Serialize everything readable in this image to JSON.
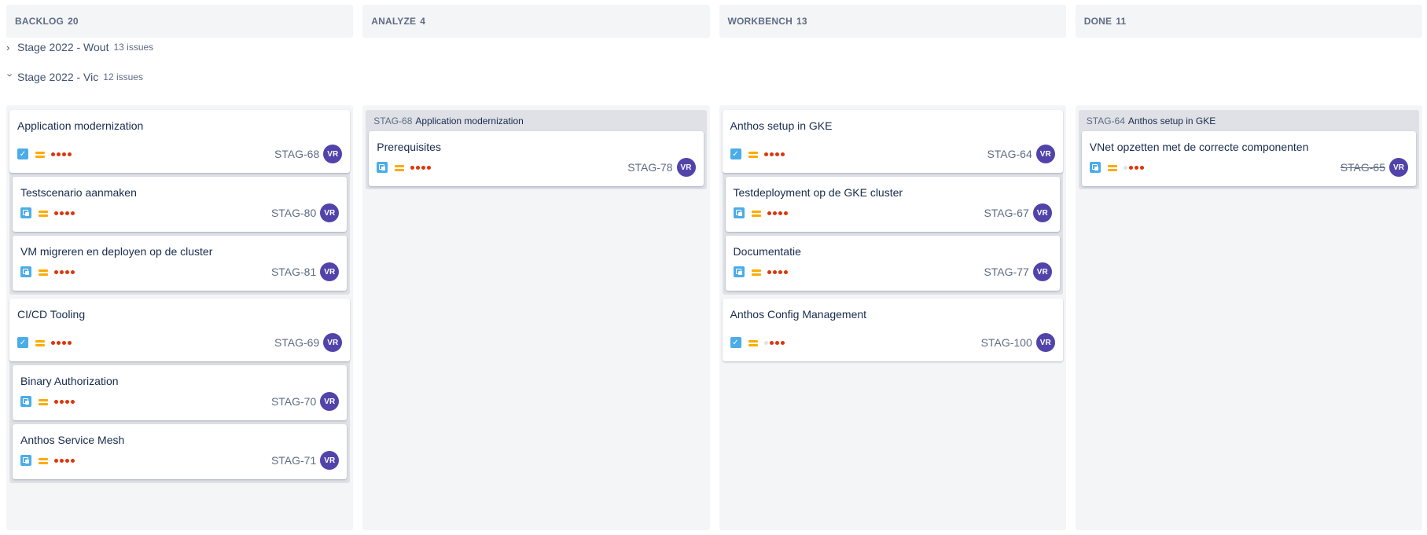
{
  "columns": [
    {
      "name": "BACKLOG",
      "count": "20"
    },
    {
      "name": "ANALYZE",
      "count": "4"
    },
    {
      "name": "WORKBENCH",
      "count": "13"
    },
    {
      "name": "DONE",
      "count": "11"
    }
  ],
  "swimlanes": [
    {
      "name": "Stage 2022 - Wout",
      "issues": "13 issues",
      "expanded": false
    },
    {
      "name": "Stage 2022 - Vic",
      "issues": "12 issues",
      "expanded": true
    }
  ],
  "avatar_initials": "VR",
  "colors": {
    "avatar": "#5243aa",
    "issue_type": "#4bade8",
    "priority_medium": "#ffab00",
    "estimate_dot": "#de350b"
  },
  "backlog": {
    "group1": {
      "parent": {
        "title": "Application modernization",
        "key": "STAG-68",
        "type": "story"
      },
      "children": [
        {
          "title": "Testscenario aanmaken",
          "key": "STAG-80",
          "type": "subtask"
        },
        {
          "title": "VM migreren en deployen op de cluster",
          "key": "STAG-81",
          "type": "subtask"
        }
      ]
    },
    "group2": {
      "parent": {
        "title": "CI/CD Tooling",
        "key": "STAG-69",
        "type": "story"
      },
      "children": [
        {
          "title": "Binary Authorization",
          "key": "STAG-70",
          "type": "subtask"
        },
        {
          "title": "Anthos Service Mesh",
          "key": "STAG-71",
          "type": "subtask"
        }
      ]
    }
  },
  "analyze": {
    "group_key": "STAG-68",
    "group_title": "Application modernization",
    "card": {
      "title": "Prerequisites",
      "key": "STAG-78",
      "type": "subtask"
    }
  },
  "workbench": {
    "group1": {
      "parent": {
        "title": "Anthos setup in GKE",
        "key": "STAG-64",
        "type": "story"
      },
      "children": [
        {
          "title": "Testdeployment op de GKE cluster",
          "key": "STAG-67",
          "type": "subtask"
        },
        {
          "title": "Documentatie",
          "key": "STAG-77",
          "type": "subtask"
        }
      ]
    },
    "standalone": {
      "title": "Anthos Config Management",
      "key": "STAG-100",
      "type": "story"
    }
  },
  "done": {
    "group_key": "STAG-64",
    "group_title": "Anthos setup in GKE",
    "card": {
      "title": "VNet opzetten met de correcte componenten",
      "key": "STAG-65",
      "type": "subtask"
    }
  }
}
